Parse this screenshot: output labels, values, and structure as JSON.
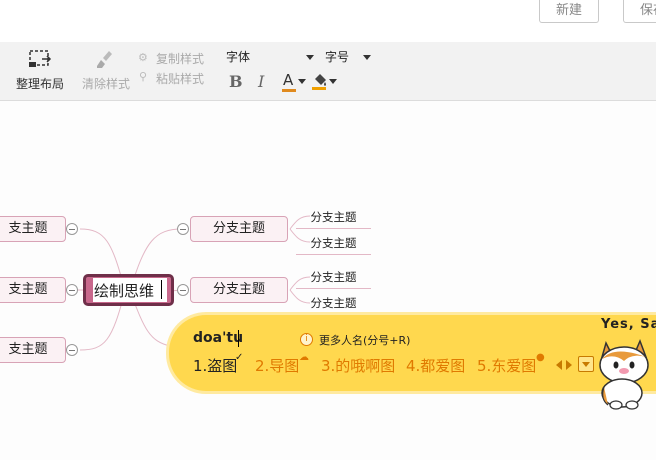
{
  "top": {
    "new_label": "新建",
    "save_label": "保存"
  },
  "toolbar": {
    "arrange_label": "整理布局",
    "clear_style_label": "清除样式",
    "copy_style_label": "复制样式",
    "paste_style_label": "粘贴样式",
    "font_label": "字体",
    "size_label": "字号",
    "bold": "B",
    "italic": "I",
    "font_color": "A",
    "font_color_value": "#e08a1e"
  },
  "mindmap": {
    "root": "绘制思维",
    "left_nodes": [
      "支主题",
      "支主题",
      "支主题"
    ],
    "right_nodes": [
      "分支主题",
      "分支主题"
    ],
    "sub_nodes": [
      "分支主题",
      "分支主题",
      "分支主题",
      "分支主题"
    ]
  },
  "ime": {
    "input": "doa'tu",
    "hint": "更多人名(分号+R)",
    "candidates": [
      "1.盗图",
      "2.导图",
      "3.的哦啊图",
      "4.都爱图",
      "5.东爱图"
    ],
    "mascot_text": "Yes, Sa",
    "accent": "#ffd84e"
  }
}
